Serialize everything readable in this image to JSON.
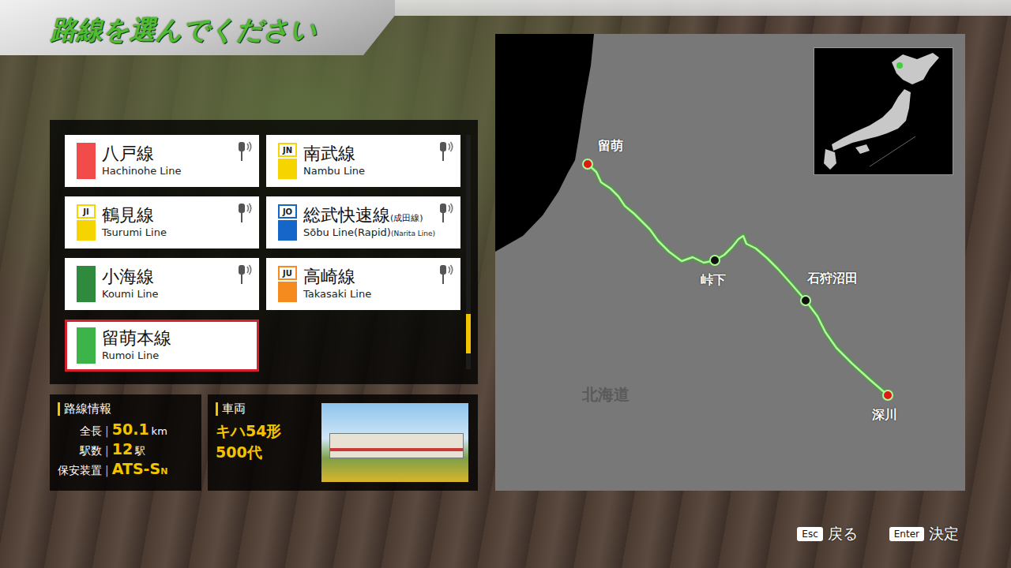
{
  "title": "路線を選んでください",
  "routes": [
    {
      "name": "八戸線",
      "suffix": "",
      "english": "Hachinohe Line",
      "english_suffix": "",
      "code": "",
      "color": "#f24b4b",
      "signal": true,
      "selected": false
    },
    {
      "name": "南武線",
      "suffix": "",
      "english": "Nambu Line",
      "english_suffix": "",
      "code": "JN",
      "color": "#f5d400",
      "signal": true,
      "selected": false
    },
    {
      "name": "鶴見線",
      "suffix": "",
      "english": "Tsurumi Line",
      "english_suffix": "",
      "code": "JI",
      "color": "#f5d400",
      "signal": true,
      "selected": false
    },
    {
      "name": "総武快速線",
      "suffix": "(成田線)",
      "english": "Sōbu Line(Rapid)",
      "english_suffix": "(Narita Line)",
      "code": "JO",
      "color": "#1566c8",
      "signal": true,
      "selected": false
    },
    {
      "name": "小海線",
      "suffix": "",
      "english": "Koumi Line",
      "english_suffix": "",
      "code": "",
      "color": "#2f8a3e",
      "signal": true,
      "selected": false
    },
    {
      "name": "高崎線",
      "suffix": "",
      "english": "Takasaki Line",
      "english_suffix": "",
      "code": "JU",
      "color": "#f58a1f",
      "signal": true,
      "selected": false
    },
    {
      "name": "留萌本線",
      "suffix": "",
      "english": "Rumoi Line",
      "english_suffix": "",
      "code": "",
      "color": "#3cb44a",
      "signal": false,
      "selected": true
    }
  ],
  "scroll": {
    "position": 0.92
  },
  "route_info": {
    "heading": "路線情報",
    "separator": "|",
    "rows": [
      {
        "label": "全長",
        "value": "50.1",
        "sub": "",
        "unit": "km"
      },
      {
        "label": "駅数",
        "value": "12",
        "sub": "",
        "unit": "駅"
      },
      {
        "label": "保安装置",
        "value": "ATS-S",
        "sub": "N",
        "unit": ""
      }
    ]
  },
  "vehicle": {
    "heading": "車両",
    "lines": [
      "キハ54形",
      "500代"
    ]
  },
  "map": {
    "region": "北海道",
    "stations": [
      {
        "name": "留萌",
        "terminal": true
      },
      {
        "name": "峠下",
        "terminal": false
      },
      {
        "name": "石狩沼田",
        "terminal": false
      },
      {
        "name": "深川",
        "terminal": true
      }
    ]
  },
  "keys": [
    {
      "key": "Esc",
      "label": "戻る"
    },
    {
      "key": "Enter",
      "label": "決定"
    }
  ]
}
